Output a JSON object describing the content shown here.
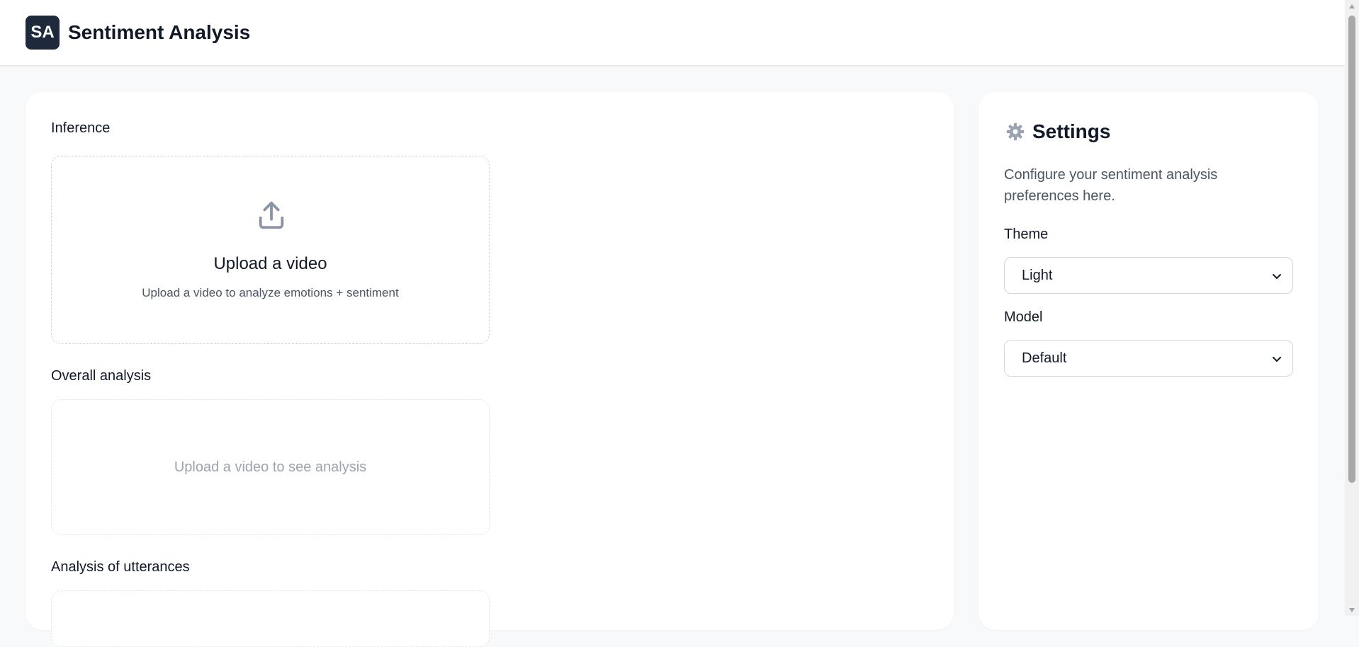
{
  "header": {
    "logo_text": "SA",
    "title": "Sentiment Analysis"
  },
  "inference": {
    "title": "Inference",
    "upload": {
      "icon": "upload-icon",
      "title": "Upload a video",
      "subtitle": "Upload a video to analyze emotions + sentiment"
    }
  },
  "overall": {
    "title": "Overall analysis",
    "placeholder": "Upload a video to see analysis"
  },
  "utterances": {
    "title": "Analysis of utterances"
  },
  "settings": {
    "icon": "gear-icon",
    "title": "Settings",
    "description": "Configure your sentiment analysis preferences here.",
    "theme": {
      "label": "Theme",
      "value": "Light"
    },
    "model": {
      "label": "Model",
      "value": "Default"
    }
  },
  "colors": {
    "logo_bg": "#1e293b",
    "page_bg": "#f8f9fb",
    "muted_text": "#9ca3af"
  }
}
